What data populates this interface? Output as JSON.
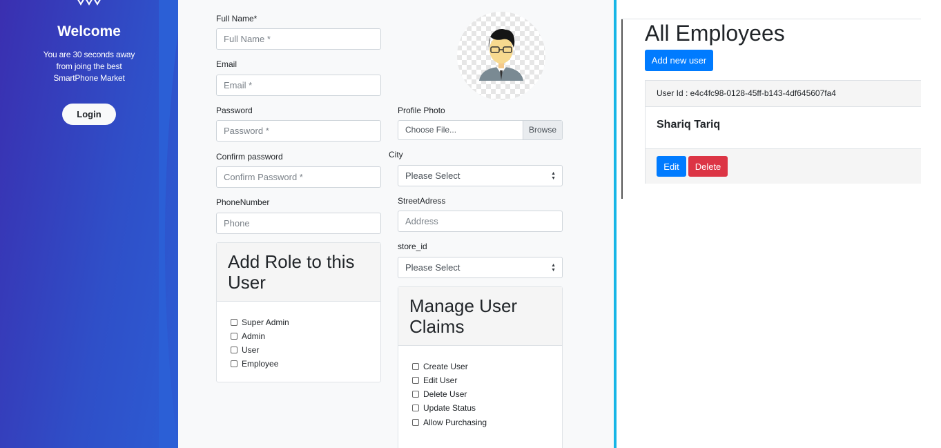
{
  "sidebar": {
    "welcome": "Welcome",
    "tagline": "You are 30 seconds away from joing the best SmartPhone Market",
    "login_label": "Login"
  },
  "form": {
    "fullname": {
      "label": "Full Name*",
      "placeholder": "Full Name *"
    },
    "email": {
      "label": "Email",
      "placeholder": "Email *"
    },
    "password": {
      "label": "Password",
      "placeholder": "Password *"
    },
    "confirm_password": {
      "label": "Confirm password",
      "placeholder": "Confirm Password *"
    },
    "phone": {
      "label": "PhoneNumber",
      "placeholder": "Phone"
    },
    "profile_photo": {
      "label": "Profile Photo",
      "value": "Choose File...",
      "browse": "Browse"
    },
    "city": {
      "label": "City",
      "value": "Please Select"
    },
    "street": {
      "label": "StreetAdress",
      "placeholder": "Address"
    },
    "store": {
      "label": "store_id",
      "value": "Please Select"
    }
  },
  "roles": {
    "title": "Add Role to this User",
    "items": [
      "Super Admin",
      "Admin",
      "User",
      "Employee"
    ]
  },
  "claims": {
    "title": "Manage User Claims",
    "items": [
      "Create User",
      "Edit User",
      "Delete User",
      "Update Status",
      "Allow Purchasing"
    ]
  },
  "employees": {
    "title": "All Employees",
    "add_label": "Add new user",
    "card": {
      "user_id": "User Id : e4c4fc98-0128-45ff-b143-4df645607fa4",
      "name": "Shariq Tariq",
      "edit_label": "Edit",
      "delete_label": "Delete"
    }
  },
  "colors": {
    "primary": "#007bff",
    "danger": "#dc3545",
    "divider": "#17b6e6",
    "gradient_start": "#3a2fb0",
    "gradient_end": "#2b5fd6"
  }
}
